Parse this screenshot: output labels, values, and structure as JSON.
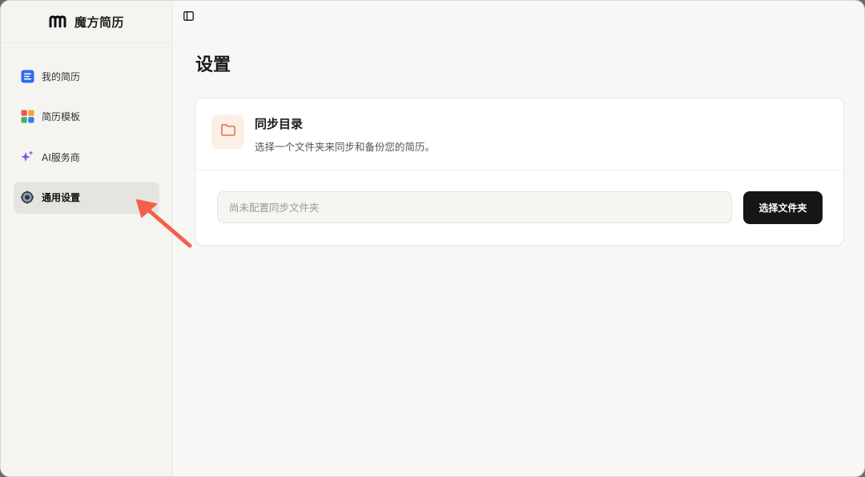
{
  "app": {
    "name": "魔方简历"
  },
  "sidebar": {
    "items": [
      {
        "label": "我的简历",
        "icon": "document-icon"
      },
      {
        "label": "简历模板",
        "icon": "template-grid-icon"
      },
      {
        "label": "AI服务商",
        "icon": "sparkle-icon"
      },
      {
        "label": "通用设置",
        "icon": "gear-icon",
        "active": true
      }
    ]
  },
  "main": {
    "title": "设置",
    "sync": {
      "title": "同步目录",
      "description": "选择一个文件夹来同步和备份您的简历。",
      "input_value": "",
      "input_placeholder": "尚未配置同步文件夹",
      "button_label": "选择文件夹"
    }
  },
  "colors": {
    "accent": "#161616",
    "folder_tint": "#fcefe6",
    "folder_stroke": "#d9774e",
    "annotation_arrow": "#f2604c",
    "doc_icon": "#2f6bf0"
  }
}
